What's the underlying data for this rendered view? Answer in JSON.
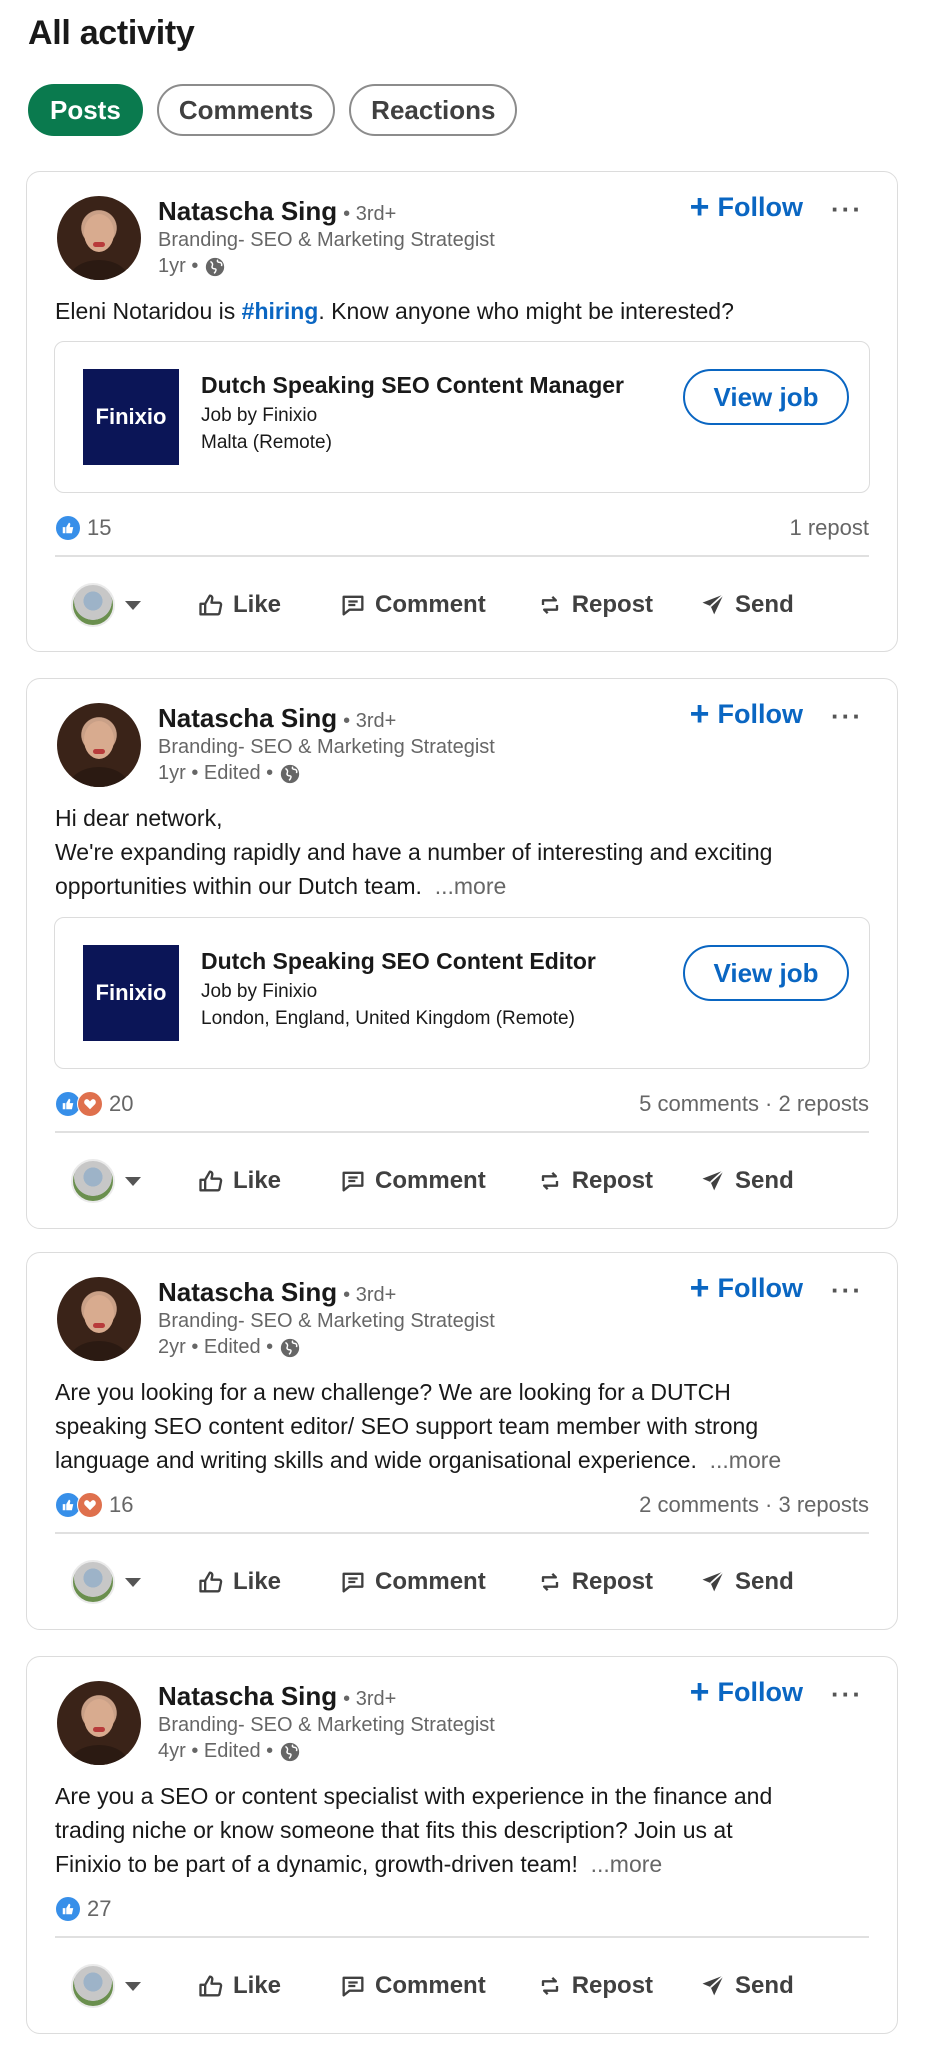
{
  "page": {
    "title": "All activity"
  },
  "filters": [
    {
      "label": "Posts",
      "active": true
    },
    {
      "label": "Comments",
      "active": false
    },
    {
      "label": "Reactions",
      "active": false
    }
  ],
  "posts": [
    {
      "author": "Natascha Sing",
      "degree": "• 3rd+",
      "headline": "Branding- SEO & Marketing Strategist",
      "meta": "1yr •",
      "follow_label": "Follow",
      "text_before": "Eleni Notaridou is ",
      "hashtag": "#hiring",
      "text_after": ". Know anyone who might be interested?",
      "job": {
        "logo_text": "Finixio",
        "title": "Dutch Speaking SEO Content Manager",
        "company": "Job by Finixio",
        "location": "Malta (Remote)",
        "button": "View job"
      },
      "reaction_count": "15",
      "engagement": "1 repost",
      "actions": {
        "like": "Like",
        "comment": "Comment",
        "repost": "Repost",
        "send": "Send"
      }
    },
    {
      "author": "Natascha Sing",
      "degree": "• 3rd+",
      "headline": "Branding- SEO & Marketing Strategist",
      "meta": "1yr • Edited •",
      "follow_label": "Follow",
      "line1": "Hi dear network,",
      "line2": "We're expanding rapidly and have a number of interesting and exciting",
      "line3": "opportunities within our Dutch team.",
      "see_more": "...more",
      "job": {
        "logo_text": "Finixio",
        "title": "Dutch Speaking SEO Content Editor",
        "company": "Job by Finixio",
        "location": "London, England, United Kingdom (Remote)",
        "button": "View job"
      },
      "reaction_count": "20",
      "engagement": "5 comments · 2 reposts",
      "actions": {
        "like": "Like",
        "comment": "Comment",
        "repost": "Repost",
        "send": "Send"
      }
    },
    {
      "author": "Natascha Sing",
      "degree": "• 3rd+",
      "headline": "Branding- SEO & Marketing Strategist",
      "meta": "2yr • Edited •",
      "follow_label": "Follow",
      "line1": "Are you looking for a new challenge? We are looking for a DUTCH",
      "line2": "speaking SEO content editor/ SEO support team member with strong",
      "line3": "language and writing skills and wide organisational experience.",
      "see_more": "...more",
      "reaction_count": "16",
      "engagement": "2 comments · 3 reposts",
      "actions": {
        "like": "Like",
        "comment": "Comment",
        "repost": "Repost",
        "send": "Send"
      }
    },
    {
      "author": "Natascha Sing",
      "degree": "• 3rd+",
      "headline": "Branding- SEO & Marketing Strategist",
      "meta": "4yr • Edited •",
      "follow_label": "Follow",
      "line1": "Are you a SEO or content specialist with experience in the finance and",
      "line2": "trading niche or know someone that fits this description? Join us at",
      "line3": "Finixio to be part of a dynamic, growth-driven team!",
      "see_more": "...more",
      "reaction_count": "27",
      "engagement": "",
      "actions": {
        "like": "Like",
        "comment": "Comment",
        "repost": "Repost",
        "send": "Send"
      }
    }
  ],
  "colors": {
    "accent": "#0a66c2",
    "filter_active": "#0a7a4e",
    "logo_bg": "#0b1557"
  },
  "icons": [
    "globe-icon",
    "plus-icon",
    "more-icon",
    "like-icon",
    "comment-icon",
    "repost-icon",
    "send-icon",
    "like-reaction-icon",
    "love-reaction-icon"
  ]
}
